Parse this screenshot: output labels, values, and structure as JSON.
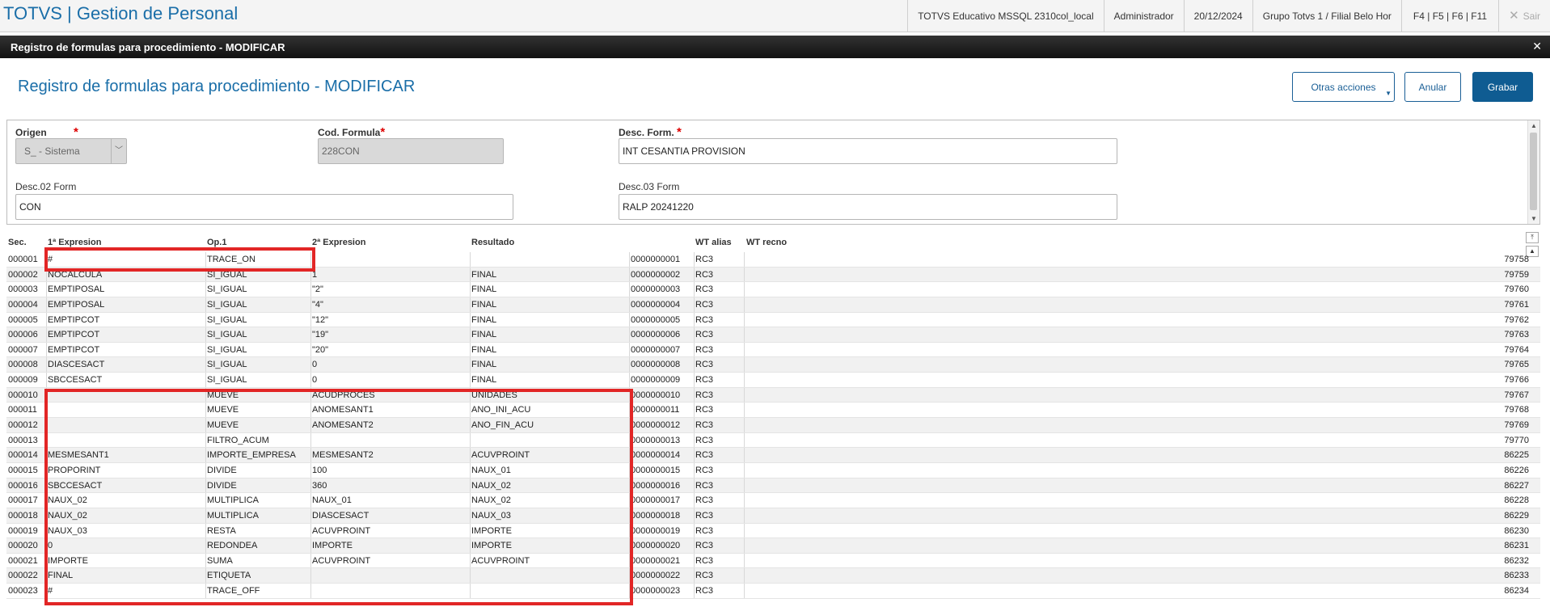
{
  "app": {
    "title": "TOTVS | Gestion de Personal",
    "environment": "TOTVS Educativo MSSQL 2310col_local",
    "user": "Administrador",
    "date": "20/12/2024",
    "branch": "Grupo Totvs 1 / Filial Belo Hor",
    "shortcuts": "F4 | F5 | F6 | F11",
    "exit_label": "Sair"
  },
  "dialog": {
    "header_title": "Registro de formulas para procedimiento - MODIFICAR",
    "page_title": "Registro de formulas para procedimiento - MODIFICAR",
    "buttons": {
      "more": "Otras acciones",
      "cancel": "Anular",
      "save": "Grabar"
    }
  },
  "form": {
    "origen_label": "Origen",
    "origen_value": "S_ - Sistema",
    "cod_label": "Cod. Formula",
    "cod_value": "228CON",
    "desc_label": "Desc. Form.",
    "desc_value": "INT CESANTIA PROVISION",
    "desc02_label": "Desc.02 Form",
    "desc02_value": "CON",
    "desc03_label": "Desc.03 Form",
    "desc03_value": "RALP 20241220"
  },
  "grid": {
    "headers": {
      "sec": "Sec.",
      "e1": "1ª Expresion",
      "op": "Op.1",
      "e2": "2ª Expresion",
      "res": "Resultado",
      "wt_alias": "WT alias",
      "wt_recno": "WT recno"
    },
    "rows": [
      {
        "sec": "000001",
        "e1": "#",
        "op": "TRACE_ON",
        "e2": "",
        "res": "",
        "rec": "0000000001",
        "wt": "RC3",
        "recno": "79758"
      },
      {
        "sec": "000002",
        "e1": "NOCALCULA",
        "op": "SI_IGUAL",
        "e2": "1",
        "res": "FINAL",
        "rec": "0000000002",
        "wt": "RC3",
        "recno": "79759"
      },
      {
        "sec": "000003",
        "e1": "EMPTIPOSAL",
        "op": "SI_IGUAL",
        "e2": "\"2\"",
        "res": "FINAL",
        "rec": "0000000003",
        "wt": "RC3",
        "recno": "79760"
      },
      {
        "sec": "000004",
        "e1": "EMPTIPOSAL",
        "op": "SI_IGUAL",
        "e2": "\"4\"",
        "res": "FINAL",
        "rec": "0000000004",
        "wt": "RC3",
        "recno": "79761"
      },
      {
        "sec": "000005",
        "e1": "EMPTIPCOT",
        "op": "SI_IGUAL",
        "e2": "\"12\"",
        "res": "FINAL",
        "rec": "0000000005",
        "wt": "RC3",
        "recno": "79762"
      },
      {
        "sec": "000006",
        "e1": "EMPTIPCOT",
        "op": "SI_IGUAL",
        "e2": "\"19\"",
        "res": "FINAL",
        "rec": "0000000006",
        "wt": "RC3",
        "recno": "79763"
      },
      {
        "sec": "000007",
        "e1": "EMPTIPCOT",
        "op": "SI_IGUAL",
        "e2": "\"20\"",
        "res": "FINAL",
        "rec": "0000000007",
        "wt": "RC3",
        "recno": "79764"
      },
      {
        "sec": "000008",
        "e1": "DIASCESACT",
        "op": "SI_IGUAL",
        "e2": "0",
        "res": "FINAL",
        "rec": "0000000008",
        "wt": "RC3",
        "recno": "79765"
      },
      {
        "sec": "000009",
        "e1": "SBCCESACT",
        "op": "SI_IGUAL",
        "e2": "0",
        "res": "FINAL",
        "rec": "0000000009",
        "wt": "RC3",
        "recno": "79766"
      },
      {
        "sec": "000010",
        "e1": "",
        "op": "MUEVE",
        "e2": "ACUDPROCES",
        "res": "UNIDADES",
        "rec": "0000000010",
        "wt": "RC3",
        "recno": "79767"
      },
      {
        "sec": "000011",
        "e1": "",
        "op": "MUEVE",
        "e2": "ANOMESANT1",
        "res": "ANO_INI_ACU",
        "rec": "0000000011",
        "wt": "RC3",
        "recno": "79768"
      },
      {
        "sec": "000012",
        "e1": "",
        "op": "MUEVE",
        "e2": "ANOMESANT2",
        "res": "ANO_FIN_ACU",
        "rec": "0000000012",
        "wt": "RC3",
        "recno": "79769"
      },
      {
        "sec": "000013",
        "e1": "",
        "op": "FILTRO_ACUM",
        "e2": "",
        "res": "",
        "rec": "0000000013",
        "wt": "RC3",
        "recno": "79770"
      },
      {
        "sec": "000014",
        "e1": "MESMESANT1",
        "op": "IMPORTE_EMPRESA",
        "e2": "MESMESANT2",
        "res": "ACUVPROINT",
        "rec": "0000000014",
        "wt": "RC3",
        "recno": "86225"
      },
      {
        "sec": "000015",
        "e1": "PROPORINT",
        "op": "DIVIDE",
        "e2": "100",
        "res": "NAUX_01",
        "rec": "0000000015",
        "wt": "RC3",
        "recno": "86226"
      },
      {
        "sec": "000016",
        "e1": "SBCCESACT",
        "op": "DIVIDE",
        "e2": "360",
        "res": "NAUX_02",
        "rec": "0000000016",
        "wt": "RC3",
        "recno": "86227"
      },
      {
        "sec": "000017",
        "e1": "NAUX_02",
        "op": "MULTIPLICA",
        "e2": "NAUX_01",
        "res": "NAUX_02",
        "rec": "0000000017",
        "wt": "RC3",
        "recno": "86228"
      },
      {
        "sec": "000018",
        "e1": "NAUX_02",
        "op": "MULTIPLICA",
        "e2": "DIASCESACT",
        "res": "NAUX_03",
        "rec": "0000000018",
        "wt": "RC3",
        "recno": "86229"
      },
      {
        "sec": "000019",
        "e1": "NAUX_03",
        "op": "RESTA",
        "e2": "ACUVPROINT",
        "res": "IMPORTE",
        "rec": "0000000019",
        "wt": "RC3",
        "recno": "86230"
      },
      {
        "sec": "000020",
        "e1": "0",
        "op": "REDONDEA",
        "e2": "IMPORTE",
        "res": "IMPORTE",
        "rec": "0000000020",
        "wt": "RC3",
        "recno": "86231"
      },
      {
        "sec": "000021",
        "e1": "IMPORTE",
        "op": "SUMA",
        "e2": "ACUVPROINT",
        "res": "ACUVPROINT",
        "rec": "0000000021",
        "wt": "RC3",
        "recno": "86232"
      },
      {
        "sec": "000022",
        "e1": "FINAL",
        "op": "ETIQUETA",
        "e2": "",
        "res": "",
        "rec": "0000000022",
        "wt": "RC3",
        "recno": "86233"
      },
      {
        "sec": "000023",
        "e1": "#",
        "op": "TRACE_OFF",
        "e2": "",
        "res": "",
        "rec": "0000000023",
        "wt": "RC3",
        "recno": "86234"
      }
    ]
  },
  "colors": {
    "brand": "#1a6ea8",
    "primary_button": "#0f5c92",
    "highlight": "#e22626"
  }
}
